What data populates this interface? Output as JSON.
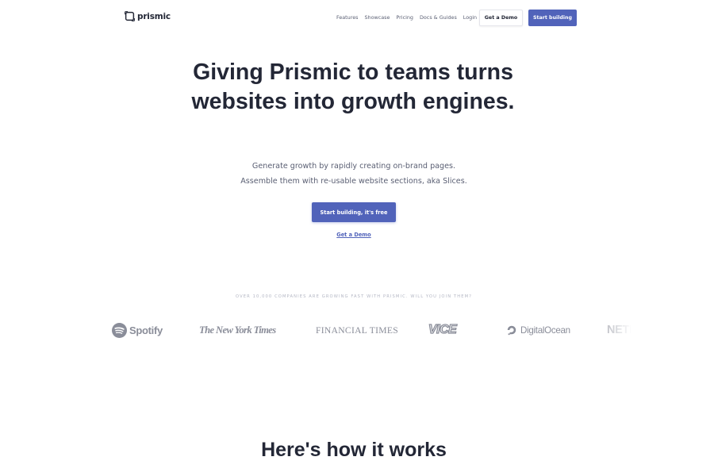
{
  "brand": {
    "name": "prismic",
    "logo_icon": "prismic-logo-icon",
    "accent_color": "#5163ba",
    "text_color": "#232736"
  },
  "nav": {
    "links": [
      "Features",
      "Showcase",
      "Pricing",
      "Docs & Guides",
      "Login"
    ],
    "demo_button": "Get a Demo",
    "start_button": "Start building"
  },
  "hero": {
    "title": "Giving Prismic to teams turns websites into growth engines.",
    "subtitle_line1": "Generate growth by rapidly creating on-brand pages.",
    "subtitle_line2": "Assemble them with re-usable website sections, aka Slices.",
    "cta_button": "Start building, it's free",
    "demo_link": "Get a Demo"
  },
  "companies": {
    "label": "Over 10,000 companies are growing fast with Prismic. Will you join them?",
    "logos": [
      {
        "name": "Spotify",
        "icon": "spotify-icon"
      },
      {
        "name": "The New York Times"
      },
      {
        "name": "FINANCIAL TIMES"
      },
      {
        "name": "VICE"
      },
      {
        "name": "DigitalOcean",
        "icon": "digitalocean-icon"
      },
      {
        "name": "NETFLIX"
      }
    ]
  },
  "how_it_works": {
    "title": "Here's how it works"
  }
}
